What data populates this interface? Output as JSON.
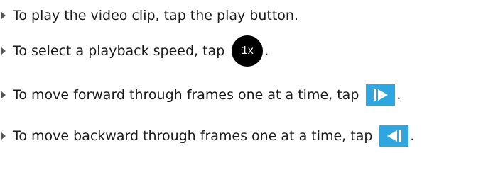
{
  "steps": [
    {
      "text": "To play the video clip, tap the play button."
    },
    {
      "text": "To select a playback speed, tap",
      "icon": {
        "name": "playback-speed-icon",
        "label": "1x",
        "color": "#000000"
      },
      "tail": "."
    },
    {
      "text": "To move forward through frames one at a time, tap",
      "icon": {
        "name": "frame-forward-icon",
        "color": "#2fa6df"
      },
      "tail": "."
    },
    {
      "text": "To move backward through frames one at a time, tap",
      "icon": {
        "name": "frame-backward-icon",
        "color": "#2fa6df"
      },
      "tail": "."
    }
  ]
}
